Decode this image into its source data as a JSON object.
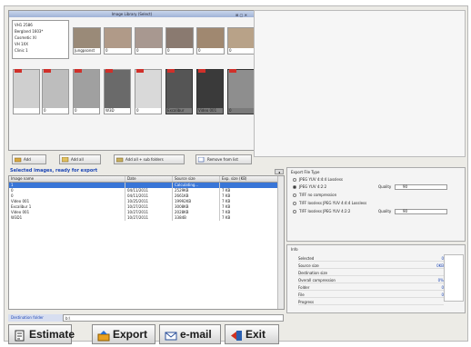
{
  "library": {
    "title": "Image Library (Select)",
    "ctrl": "⊞ ▢ ✕",
    "folders": [
      "VH1 2586",
      "Bergland 1603*",
      "Cosmetic XI",
      "VH 1XX",
      "Clinic 1"
    ],
    "thumbs_top": [
      {
        "caption": "",
        "color": "#9a8a78"
      },
      {
        "caption": "",
        "color": "#b09a88"
      },
      {
        "caption": "",
        "color": "#a89890"
      },
      {
        "caption": "",
        "color": "#8a7a70"
      },
      {
        "caption": "",
        "color": "#a08870"
      },
      {
        "caption": "",
        "color": "#b8a288"
      }
    ],
    "captions_top": [
      "Jungpsonst",
      "0",
      "0",
      "0",
      "0",
      "0"
    ],
    "thumbs_bottom": [
      {
        "caption": "",
        "color": "#cfcfcf"
      },
      {
        "caption": "0",
        "color": "#bdbdbd"
      },
      {
        "caption": "0",
        "color": "#a0a0a0"
      },
      {
        "caption": "W3D",
        "color": "#6a6a6a"
      },
      {
        "caption": "0",
        "color": "#d9d9d9"
      },
      {
        "caption": "Excalibur",
        "color": "#555555"
      },
      {
        "caption": "Video 001",
        "color": "#3a3a3a"
      },
      {
        "caption": "0",
        "color": "#8e8e8e"
      }
    ]
  },
  "buttons": {
    "add": "Add",
    "add_all": "Add all",
    "add_all_sub": "Add all + sub folders",
    "remove": "Remove from list"
  },
  "selected": {
    "title": "Selected images, ready for export",
    "columns": [
      "Image name",
      "Date",
      "Source size",
      "Exp. size (KB)"
    ],
    "rows": [
      [
        "1",
        "",
        "Calculating...",
        ""
      ],
      [
        "0",
        "04/11/2011",
        "2529KB",
        "7 KB"
      ],
      [
        "0",
        "04/11/2011",
        "2661KB",
        "7 KB"
      ],
      [
        "Video 001",
        "10/25/2011",
        "19992KB",
        "7 KB"
      ],
      [
        "Excalibur 1",
        "10/27/2011",
        "3008KB",
        "7 KB"
      ],
      [
        "Video 001",
        "10/27/2011",
        "2028KB",
        "7 KB"
      ],
      [
        "W3D1",
        "10/27/2011",
        "3384B",
        "7 KB"
      ]
    ]
  },
  "destination": {
    "label": "Destination folder",
    "value": "b:\\"
  },
  "bottom": {
    "estimate": "Estimate",
    "export": "Export",
    "email": "e-mail",
    "exit": "Exit"
  },
  "export_panel": {
    "title": "Export File Type",
    "options": [
      "JPEG YUV 4:4:4 Lossless",
      "JPEG YUV 4:2:2",
      "TIFF no compression",
      "TIFF lossless JPEG YUV 4:4:4 Lossless",
      "TIFF lossless JPEG YUV 4:2:2"
    ],
    "quality_label": "Quality",
    "quality_value": "90"
  },
  "info": {
    "title": "Info",
    "rows": [
      {
        "k": "Selected",
        "v": "0"
      },
      {
        "k": "Source size",
        "v": "0KB"
      },
      {
        "k": "Destination size",
        "v": ""
      },
      {
        "k": "Overall compression",
        "v": "0%"
      },
      {
        "k": "Folder",
        "v": "0"
      },
      {
        "k": "File",
        "v": "0"
      },
      {
        "k": "Progress",
        "v": ""
      }
    ]
  },
  "colors": {
    "accent": "#1c46b5",
    "selection": "#3875d7"
  }
}
